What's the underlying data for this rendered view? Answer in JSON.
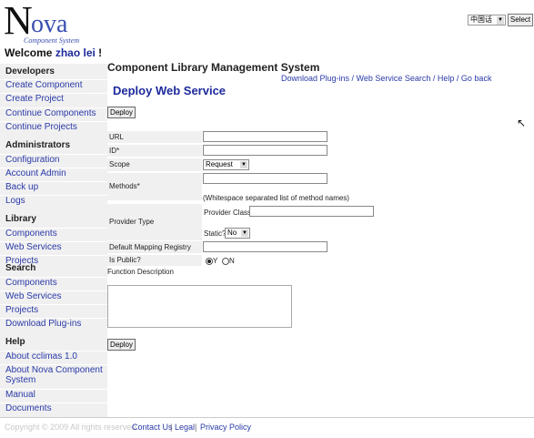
{
  "header": {
    "logo_big": "N",
    "logo_rest": "ova",
    "logo_sub": "Component System",
    "welcome": "Welcome",
    "user": "zhao lei",
    "exclaim": "!",
    "language_value": "中国话",
    "select_label": "Select"
  },
  "sidebar": {
    "developers": {
      "title": "Developers",
      "items": [
        "Create Component",
        "Create Project",
        "Continue Components",
        "Continue Projects"
      ]
    },
    "administrators": {
      "title": "Administrators",
      "items": [
        "Configuration",
        "Account Admin",
        "Back up",
        "Logs"
      ]
    },
    "library": {
      "title": "Library",
      "items": [
        "Components",
        "Web Services",
        "Projects"
      ]
    },
    "search": {
      "title": "Search",
      "items": [
        "Components",
        "Web Services",
        "Projects",
        "Download Plug-ins"
      ]
    },
    "help": {
      "title": "Help",
      "items": [
        "About cclimas 1.0",
        "About Nova Component",
        "System",
        "Manual",
        "Documents"
      ]
    }
  },
  "main": {
    "app_title": "Component Library Management System",
    "links": "Download Plug-ins / Web Service Search / Help / Go back",
    "page_title": "Deploy Web Service",
    "deploy_label": "Deploy",
    "form": {
      "url_label": "URL",
      "id_label": "ID*",
      "scope_label": "Scope",
      "scope_value": "Request",
      "methods_label": "Methods*",
      "methods_hint": "(Whitespace separated list of method names)",
      "provider_type_label": "Provider Type",
      "provider_class_label": "Provider Class:",
      "static_label": "Static?",
      "static_value": "No",
      "mapping_label": "Default Mapping Registry Class",
      "public_label": "Is Public?",
      "yes_label": "Y",
      "no_label": "N",
      "description_label": "Function Description"
    }
  },
  "footer": {
    "copyright": "Copyright © 2009 All rights reserved.",
    "contact": "Contact Us",
    "legal": "Legal",
    "privacy": "Privacy Policy",
    "sep": "|"
  }
}
